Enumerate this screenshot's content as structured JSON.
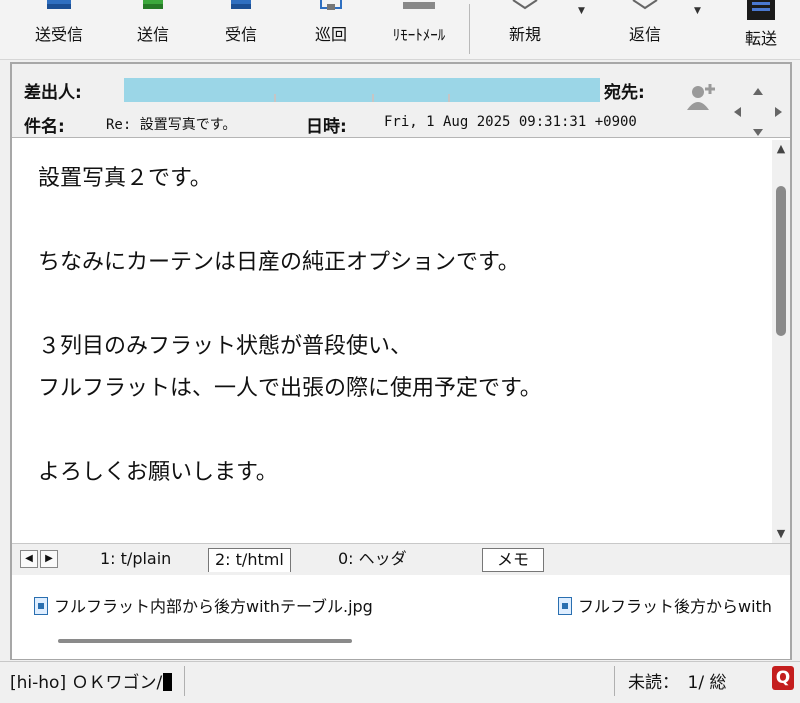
{
  "toolbar": {
    "buttons": [
      {
        "label": "送受信",
        "icon": "send-receive-icon"
      },
      {
        "label": "送信",
        "icon": "send-icon"
      },
      {
        "label": "受信",
        "icon": "receive-icon"
      },
      {
        "label": "巡回",
        "icon": "patrol-icon"
      },
      {
        "label": "ﾘﾓｰﾄﾒｰﾙ",
        "icon": "remote-mail-icon"
      },
      {
        "label": "新規",
        "icon": "new-mail-icon"
      },
      {
        "label": "返信",
        "icon": "reply-icon"
      },
      {
        "label": "転送",
        "icon": "forward-icon"
      }
    ]
  },
  "header": {
    "from_label": "差出人:",
    "to_label": "宛先:",
    "subject_label": "件名:",
    "subject": "Re: 設置写真です。",
    "date_label": "日時:",
    "date": "Fri, 1 Aug 2025 09:31:31 +0900"
  },
  "body": {
    "lines": [
      "設置写真２です。",
      "",
      "ちなみにカーテンは日産の純正オプションです。",
      "",
      "３列目のみフラット状態が普段使い、",
      "フルフラットは、一人で出張の際に使用予定です。",
      "",
      "よろしくお願いします。"
    ]
  },
  "tabs": {
    "items": [
      "1: t/plain",
      "2: t/html",
      "0: ヘッダ"
    ],
    "active_index": 1,
    "memo": "メモ"
  },
  "attachments": [
    "フルフラット内部から後方withテーブル.jpg",
    "フルフラット後方からwith"
  ],
  "status": {
    "folder": "[hi-ho] ＯＫワゴン/",
    "unread": "未読：　1/ 総"
  },
  "colors": {
    "sender_highlight": "#9bd6e7",
    "brand_q": "#c41e1e"
  }
}
